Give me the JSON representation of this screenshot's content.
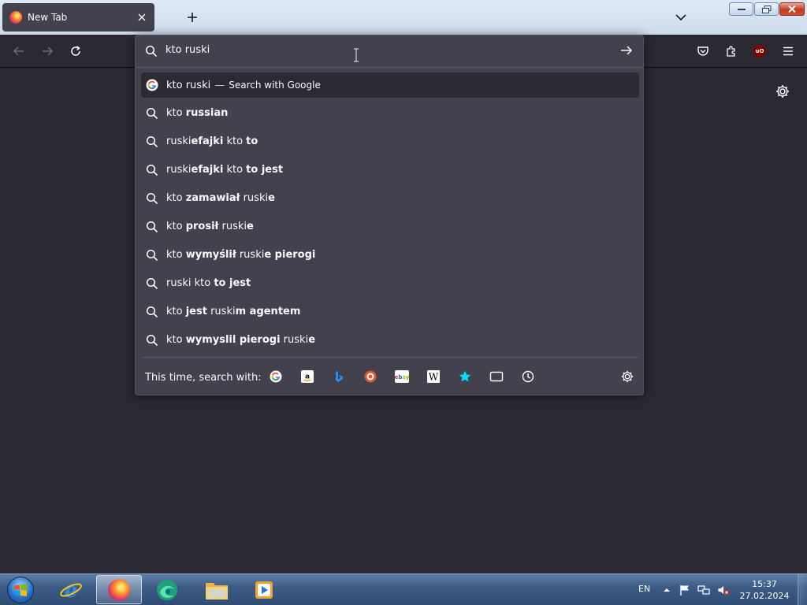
{
  "tab": {
    "title": "New Tab"
  },
  "urlbar": {
    "value": "kto ruski",
    "suggestions": [
      {
        "icon": "google-icon",
        "parts": [
          {
            "t": "kto ruski",
            "b": false
          }
        ],
        "dash": "—",
        "action": "Search with Google"
      },
      {
        "icon": "search-icon",
        "parts": [
          {
            "t": "kto ",
            "b": false
          },
          {
            "t": "russian",
            "b": true
          }
        ]
      },
      {
        "icon": "search-icon",
        "parts": [
          {
            "t": "ruski",
            "b": false
          },
          {
            "t": "efajki",
            "b": true
          },
          {
            "t": " kto ",
            "b": false
          },
          {
            "t": "to",
            "b": true
          }
        ]
      },
      {
        "icon": "search-icon",
        "parts": [
          {
            "t": "ruski",
            "b": false
          },
          {
            "t": "efajki",
            "b": true
          },
          {
            "t": " kto ",
            "b": false
          },
          {
            "t": "to jest",
            "b": true
          }
        ]
      },
      {
        "icon": "search-icon",
        "parts": [
          {
            "t": "kto ",
            "b": false
          },
          {
            "t": "zamawiał",
            "b": true
          },
          {
            "t": " ruski",
            "b": false
          },
          {
            "t": "e",
            "b": true
          }
        ]
      },
      {
        "icon": "search-icon",
        "parts": [
          {
            "t": "kto ",
            "b": false
          },
          {
            "t": "prosił",
            "b": true
          },
          {
            "t": " ruski",
            "b": false
          },
          {
            "t": "e",
            "b": true
          }
        ]
      },
      {
        "icon": "search-icon",
        "parts": [
          {
            "t": "kto ",
            "b": false
          },
          {
            "t": "wymyślił",
            "b": true
          },
          {
            "t": " ruski",
            "b": false
          },
          {
            "t": "e pierogi",
            "b": true
          }
        ]
      },
      {
        "icon": "search-icon",
        "parts": [
          {
            "t": "ruski kto ",
            "b": false
          },
          {
            "t": "to jest",
            "b": true
          }
        ]
      },
      {
        "icon": "search-icon",
        "parts": [
          {
            "t": "kto ",
            "b": false
          },
          {
            "t": "jest",
            "b": true
          },
          {
            "t": " ruski",
            "b": false
          },
          {
            "t": "m agentem",
            "b": true
          }
        ]
      },
      {
        "icon": "search-icon",
        "parts": [
          {
            "t": "kto ",
            "b": false
          },
          {
            "t": "wymyslil pierogi",
            "b": true
          },
          {
            "t": " ruski",
            "b": false
          },
          {
            "t": "e",
            "b": true
          }
        ]
      }
    ],
    "oneoff_label": "This time, search with:",
    "engines": [
      "google-icon",
      "amazon-icon",
      "bing-icon",
      "duckduckgo-icon",
      "ebay-icon",
      "wikipedia-icon",
      "bookmarks-star-icon",
      "tabs-icon",
      "history-icon"
    ]
  },
  "taskbar": {
    "language": "EN",
    "time": "15:37",
    "date": "27.02.2024"
  },
  "colors": {
    "toolbar": "#2b2a33",
    "popup": "#42414d",
    "content": "#2b2a33",
    "accent_star": "#00ddff"
  }
}
